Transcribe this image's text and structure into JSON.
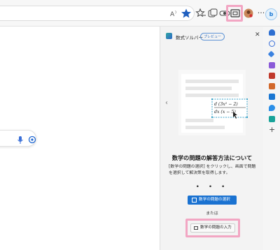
{
  "toolbar": {
    "icons": [
      "read-aloud-icon",
      "favorite-star-icon",
      "favorites-icon",
      "collections-icon",
      "tracking-icon",
      "math-solver-icon",
      "profile-icon",
      "more-icon"
    ],
    "more_label": "···"
  },
  "panel": {
    "title": "数式ソルバー",
    "badge": "プレビュー",
    "close_label": "✕",
    "heading": "数学の問題の解答方法について",
    "description": "[数学の問題の選択] をクリックし、画面で問題を選択して解決策を取得します。",
    "pager": "• • •",
    "select_button": "数学の問題の選択",
    "or_label": "または",
    "input_button": "数学の問題の入力",
    "prev_label": "‹",
    "formula_top": "d (3x² − 2)",
    "formula_bottom": "dx (x − 5)"
  },
  "sidebar": {
    "copilot_label": "b",
    "add_label": "+"
  },
  "colors": {
    "highlight": "#f2a6c3",
    "accent": "#1a72d1"
  }
}
